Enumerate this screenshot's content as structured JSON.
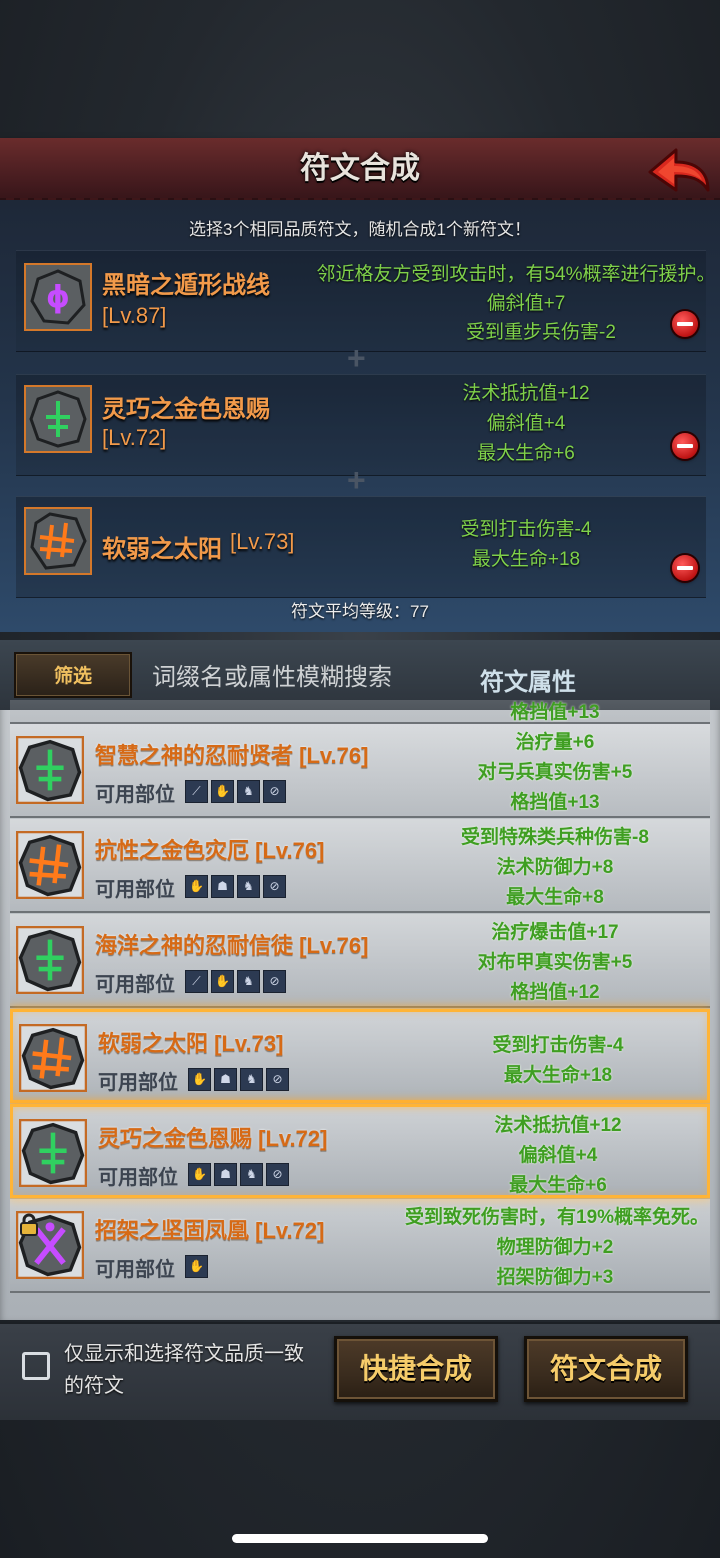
{
  "header": {
    "title": "符文合成"
  },
  "instruction": "选择3个相同品质符文，随机合成1个新符文！",
  "selected_runes": [
    {
      "name": "黑暗之遁形战线",
      "level": "[Lv.87]",
      "glyph": "ϕ",
      "glyph_color": "#c64cff",
      "stats": [
        "邻近格友方受到攻击时，有54%概率进行援护。",
        "偏斜值+7",
        "受到重步兵伤害-2"
      ]
    },
    {
      "name": "灵巧之金色恩赐",
      "level": "[Lv.72]",
      "glyph": "ǂ",
      "glyph_color": "#30d060",
      "stats": [
        "法术抵抗值+12",
        "偏斜值+4",
        "最大生命+6"
      ]
    },
    {
      "name": "软弱之太阳",
      "level": "[Lv.73]",
      "glyph": "#",
      "glyph_color": "#ff7a1a",
      "stats": [
        "受到打击伤害-4",
        "最大生命+18"
      ]
    }
  ],
  "plus_sign": "+",
  "average_level": "符文平均等级：77",
  "filter": {
    "button_label": "筛选",
    "search_placeholder": "词缀名或属性模糊搜索",
    "attribute_label": "符文属性"
  },
  "partial_top_item": {
    "stat": "格挡值+13"
  },
  "list_items": [
    {
      "name": "智慧之神的忍耐贤者 [Lv.76]",
      "parts_label": "可用部位",
      "glyph": "ǂ",
      "glyph_color": "#30d060",
      "slots": [
        "⟋",
        "✋",
        "♞",
        "⊘"
      ],
      "stats": [
        "治疗量+6",
        "对弓兵真实伤害+5",
        "格挡值+13"
      ],
      "selected": false,
      "locked": false
    },
    {
      "name": "抗性之金色灾厄 [Lv.76]",
      "parts_label": "可用部位",
      "glyph": "#",
      "glyph_color": "#ff7a1a",
      "slots": [
        "✋",
        "☗",
        "♞",
        "⊘"
      ],
      "stats": [
        "受到特殊类兵种伤害-8",
        "法术防御力+8",
        "最大生命+8"
      ],
      "selected": false,
      "locked": false
    },
    {
      "name": "海洋之神的忍耐信徒 [Lv.76]",
      "parts_label": "可用部位",
      "glyph": "ǂ",
      "glyph_color": "#30d060",
      "slots": [
        "⟋",
        "✋",
        "♞",
        "⊘"
      ],
      "stats": [
        "治疗爆击值+17",
        "对布甲真实伤害+5",
        "格挡值+12"
      ],
      "selected": false,
      "locked": false
    },
    {
      "name": "软弱之太阳 [Lv.73]",
      "parts_label": "可用部位",
      "glyph": "#",
      "glyph_color": "#ff7a1a",
      "slots": [
        "✋",
        "☗",
        "♞",
        "⊘"
      ],
      "stats": [
        "受到打击伤害-4",
        "最大生命+18"
      ],
      "selected": true,
      "locked": false
    },
    {
      "name": "灵巧之金色恩赐 [Lv.72]",
      "parts_label": "可用部位",
      "glyph": "ǂ",
      "glyph_color": "#30d060",
      "slots": [
        "✋",
        "☗",
        "♞",
        "⊘"
      ],
      "stats": [
        "法术抵抗值+12",
        "偏斜值+4",
        "最大生命+6"
      ],
      "selected": true,
      "locked": false
    },
    {
      "name": "招架之坚固凤凰 [Lv.72]",
      "parts_label": "可用部位",
      "glyph": "✕",
      "glyph_color": "#c64cff",
      "slots": [
        "✋"
      ],
      "stats": [
        "受到致死伤害时，有19%概率免死。",
        "物理防御力+2",
        "招架防御力+3"
      ],
      "selected": false,
      "locked": true
    }
  ],
  "bottom": {
    "checkbox_label": "仅显示和选择符文品质一致的符文",
    "checkbox_checked": false,
    "quick_button": "快捷合成",
    "synth_button": "符文合成"
  },
  "colors": {
    "accent_orange": "#f29a4a",
    "stat_green": "#7fd14a",
    "header_red": "#5a2426",
    "selection_gold": "#ffb436"
  }
}
